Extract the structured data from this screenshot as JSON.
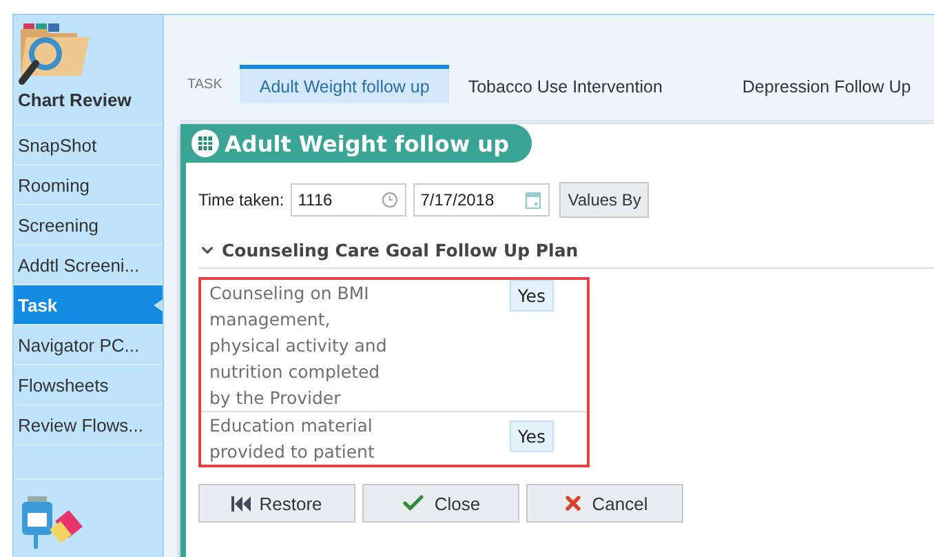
{
  "sidebar": {
    "header": "Chart Review",
    "items": [
      {
        "label": "SnapShot",
        "selected": false
      },
      {
        "label": "Rooming",
        "selected": false
      },
      {
        "label": "Screening",
        "selected": false
      },
      {
        "label": "Addtl Screeni...",
        "selected": false
      },
      {
        "label": "Task",
        "selected": true
      },
      {
        "label": "Navigator PC...",
        "selected": false
      },
      {
        "label": "Flowsheets",
        "selected": false
      },
      {
        "label": "Review Flows...",
        "selected": false
      }
    ]
  },
  "tabs": {
    "caption": "TASK",
    "items": [
      {
        "label": "Adult Weight follow up",
        "selected": true
      },
      {
        "label": "Tobacco Use Intervention",
        "selected": false
      },
      {
        "label": "Depression Follow Up",
        "selected": false
      }
    ]
  },
  "panel": {
    "title": "Adult Weight follow up",
    "time_label": "Time taken:",
    "time_value": "1116",
    "date_value": "7/17/2018",
    "values_by": "Values By",
    "section": {
      "title": "Counseling Care Goal Follow Up Plan",
      "expanded": true,
      "highlighted": true,
      "rows": [
        {
          "label": "Counseling on BMI management, physical activity and nutrition completed by the Provider",
          "answer": "Yes"
        },
        {
          "label": "Education material provided to patient",
          "answer": "Yes"
        }
      ]
    },
    "buttons": [
      {
        "label": "Restore",
        "kind": "restore"
      },
      {
        "label": "Close",
        "kind": "close"
      },
      {
        "label": "Cancel",
        "kind": "cancel"
      }
    ]
  }
}
